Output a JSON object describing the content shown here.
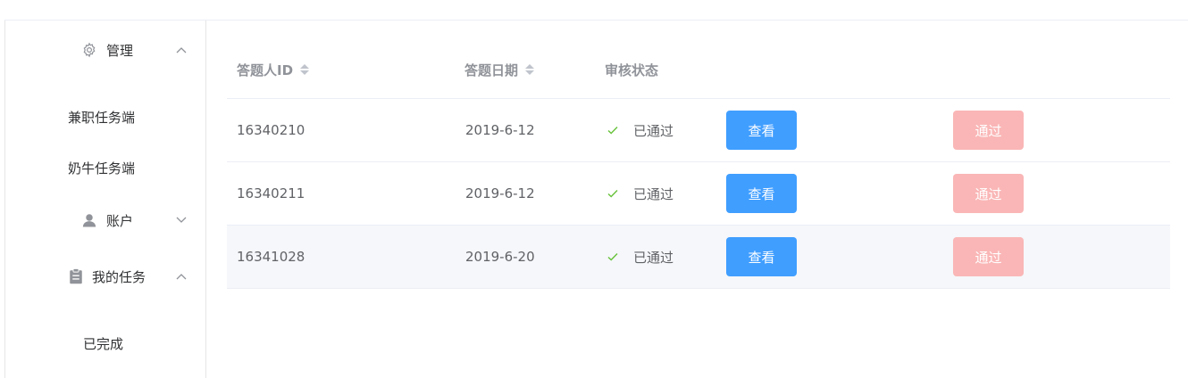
{
  "sidebar": {
    "management": {
      "label": "管理",
      "icon": "gear-icon",
      "expanded": true
    },
    "management_items": [
      {
        "label": "兼职任务端"
      },
      {
        "label": "奶牛任务端"
      }
    ],
    "account": {
      "label": "账户",
      "icon": "user-icon",
      "expanded": false
    },
    "my_tasks": {
      "label": "我的任务",
      "icon": "clipboard-icon",
      "expanded": true
    },
    "my_tasks_items": [
      {
        "label": "已完成"
      }
    ]
  },
  "table": {
    "columns": {
      "answerer_id": "答题人ID",
      "answer_date": "答题日期",
      "review_status": "审核状态"
    },
    "rows": [
      {
        "id": "16340210",
        "date": "2019-6-12",
        "status": "已通过",
        "view_label": "查看",
        "pass_label": "通过"
      },
      {
        "id": "16340211",
        "date": "2019-6-12",
        "status": "已通过",
        "view_label": "查看",
        "pass_label": "通过"
      },
      {
        "id": "16341028",
        "date": "2019-6-20",
        "status": "已通过",
        "view_label": "查看",
        "pass_label": "通过"
      }
    ]
  },
  "colors": {
    "primary": "#409eff",
    "danger_disabled": "#fab6b6",
    "success": "#67c23a",
    "header_text": "#909399",
    "hover_row": "#f5f7fa"
  }
}
